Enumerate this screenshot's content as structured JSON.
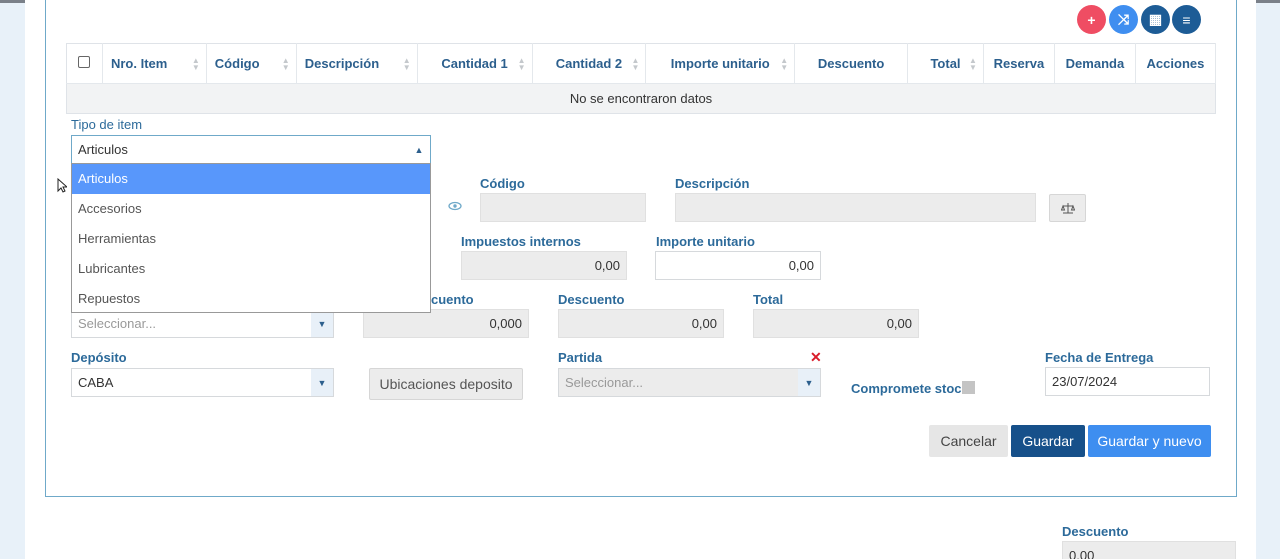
{
  "toolbar": {
    "add_icon": "+",
    "shuffle_icon": "⤨",
    "grid_icon": "▦",
    "menu_icon": "≡"
  },
  "table": {
    "headers": [
      "Nro. Item",
      "Código",
      "Descripción",
      "Cantidad 1",
      "Cantidad 2",
      "Importe unitario",
      "Descuento",
      "Total",
      "Reserva",
      "Demanda",
      "Acciones"
    ],
    "empty_text": "No se encontraron datos"
  },
  "form": {
    "tipo_item": {
      "label": "Tipo de item",
      "value": "Articulos",
      "options": [
        "Articulos",
        "Accesorios",
        "Herramientas",
        "Lubricantes",
        "Repuestos"
      ]
    },
    "codigo": {
      "label": "Código",
      "value": ""
    },
    "descripcion": {
      "label": "Descripción",
      "value": ""
    },
    "impuestos_internos": {
      "label": "Impuestos internos",
      "value": "0,00"
    },
    "importe_unitario": {
      "label": "Importe unitario",
      "value": "0,00"
    },
    "select_left": {
      "placeholder": "Seleccionar..."
    },
    "pct_descuento": {
      "label": "cuento",
      "value": "0,000"
    },
    "descuento": {
      "label": "Descuento",
      "value": "0,00"
    },
    "total": {
      "label": "Total",
      "value": "0,00"
    },
    "deposito": {
      "label": "Depósito",
      "value": "CABA"
    },
    "ubicaciones_button": "Ubicaciones deposito",
    "partida": {
      "label": "Partida",
      "placeholder": "Seleccionar..."
    },
    "compromete_stock": {
      "label": "Compromete stock"
    },
    "fecha_entrega": {
      "label": "Fecha de Entrega",
      "value": "23/07/2024"
    }
  },
  "actions": {
    "cancel": "Cancelar",
    "save": "Guardar",
    "save_new": "Guardar y nuevo"
  },
  "footer": {
    "descuento_label": "Descuento",
    "descuento_value": "0,00"
  },
  "colors": {
    "accent": "#3e8ef0",
    "navy": "#16508a",
    "red": "#ef4d63",
    "label": "#2c6a9a"
  }
}
